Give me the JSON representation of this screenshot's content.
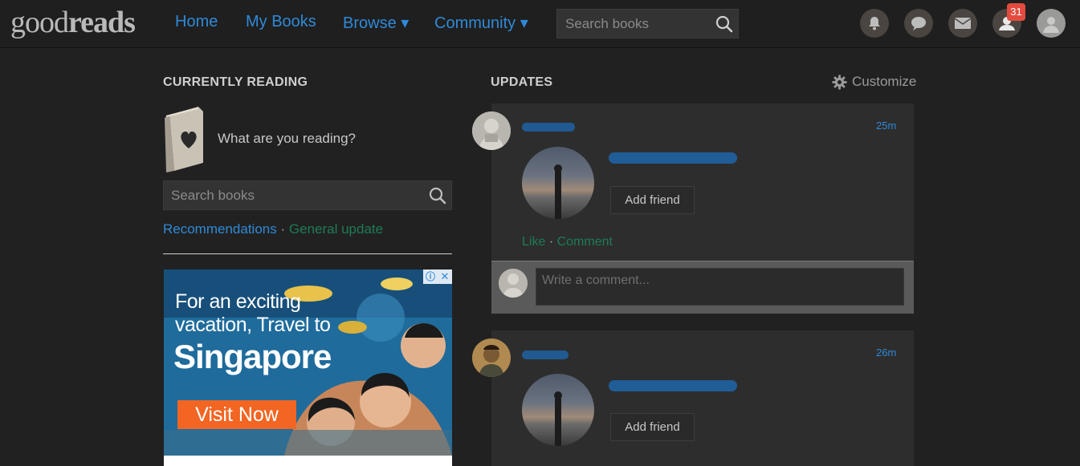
{
  "header": {
    "logo_prefix": "good",
    "logo_suffix": "reads",
    "nav": {
      "home": "Home",
      "my_books": "My Books",
      "browse": "Browse ▾",
      "community": "Community ▾"
    },
    "search_placeholder": "Search books",
    "notification_count": "31"
  },
  "currently_reading": {
    "title": "CURRENTLY READING",
    "prompt": "What are you reading?",
    "search_placeholder": "Search books",
    "links": {
      "recommendations": "Recommendations",
      "separator": "·",
      "general_update": "General update"
    }
  },
  "ad": {
    "line1": "For an exciting",
    "line2": "vacation, Travel to",
    "headline": "Singapore",
    "cta": "Visit Now",
    "info_icon": "ⓘ",
    "close_icon": "✕"
  },
  "updates": {
    "title": "UPDATES",
    "customize": "Customize",
    "items": [
      {
        "time": "25m",
        "add_friend": "Add friend",
        "like": "Like",
        "separator": "·",
        "comment": "Comment",
        "comment_placeholder": "Write a comment..."
      },
      {
        "time": "26m",
        "add_friend": "Add friend"
      }
    ]
  },
  "colors": {
    "background": "#212121",
    "link_blue": "#2e8ad8",
    "link_green": "#1e7c55",
    "badge_red": "#e34b3f",
    "ad_cta_orange": "#f26522"
  }
}
